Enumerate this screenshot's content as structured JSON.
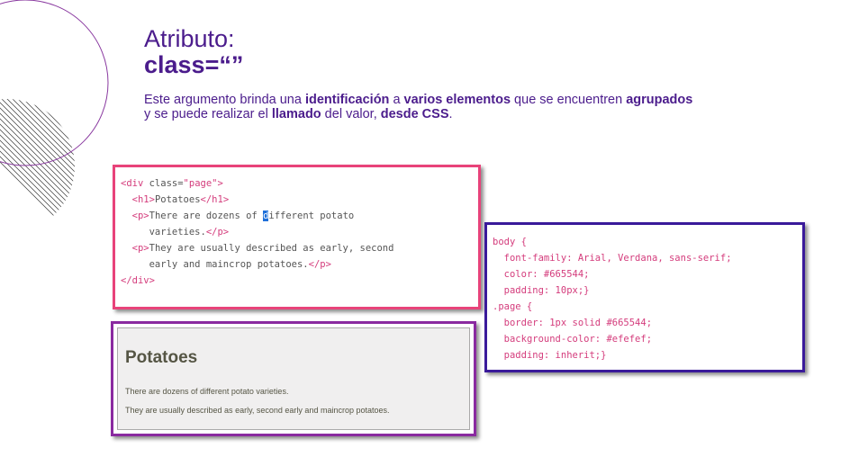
{
  "title": {
    "line1": "Atributo:",
    "line2": "class=“”"
  },
  "description": {
    "t1": "Este argumento brinda una ",
    "b1": "identificación",
    "t2": " a ",
    "b2": "varios elementos",
    "t3": " que se encuentren ",
    "b3": "agrupados",
    "t4": " y se puede realizar el ",
    "b4": "llamado",
    "t5": " del valor, ",
    "b5": "desde CSS",
    "t6": "."
  },
  "html_code": {
    "l1_open": "<div ",
    "l1_attr": "class=",
    "l1_str": "\"page\"",
    "l1_close": ">",
    "l2_open": "<h1>",
    "l2_text": "Potatoes",
    "l2_close": "</h1>",
    "l3_open": "<p>",
    "l3_text_a": "There are dozens of ",
    "l3_cursor": "d",
    "l3_text_b": "ifferent potato",
    "l4_text": "varieties.",
    "l4_close": "</p>",
    "l5_open": "<p>",
    "l5_text": "They are usually described as early, second",
    "l6_text": "early and maincrop potatoes.",
    "l6_close": "</p>",
    "l7_close": "</div>"
  },
  "css_code": {
    "l1": "body {",
    "l2": "font-family: Arial, Verdana, sans-serif;",
    "l3": "color: #665544;",
    "l4": "padding: 10px;}",
    "l5": ".page {",
    "l6": "border: 1px solid #665544;",
    "l7": "background-color: #efefef;",
    "l8": "padding: inherit;}"
  },
  "preview": {
    "heading": "Potatoes",
    "p1": "There are dozens of different potato varieties.",
    "p2": "They are usually described as early, second early and maincrop potatoes."
  },
  "colors": {
    "accent": "#4b1c8c",
    "html_border": "#e8437a",
    "css_border": "#3a1a9a",
    "preview_border": "#8a2aa0"
  }
}
